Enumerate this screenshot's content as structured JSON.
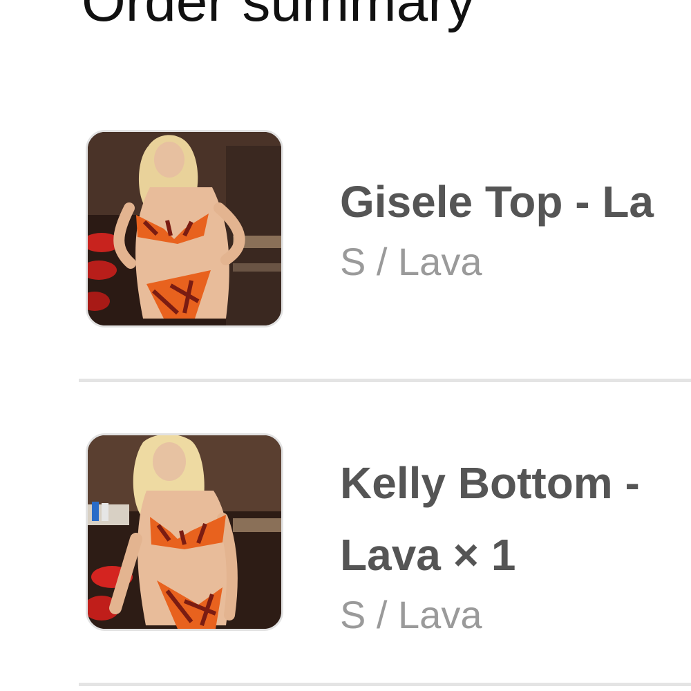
{
  "order_summary": {
    "heading": "Order summary",
    "items": [
      {
        "title": "Gisele Top - La",
        "variant": "S / Lava",
        "image_alt": "Gisele Top in Lava print"
      },
      {
        "title_line1": "Kelly Bottom -",
        "title_line2": "Lava × 1",
        "variant": "S / Lava",
        "image_alt": "Kelly Bottom in Lava print"
      }
    ]
  },
  "colors": {
    "heading": "#111111",
    "title": "#555555",
    "variant": "#9a9a9a",
    "divider": "#e4e4e4",
    "print_orange": "#e8621e",
    "print_dark": "#7a1c12"
  }
}
